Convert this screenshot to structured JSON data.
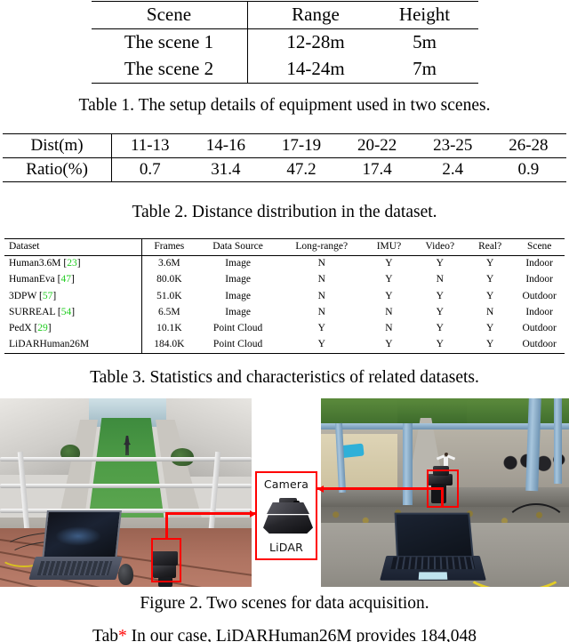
{
  "table1": {
    "headers": [
      "Scene",
      "Range",
      "Height"
    ],
    "rows": [
      [
        "The scene 1",
        "12-28m",
        "5m"
      ],
      [
        "The scene 2",
        "14-24m",
        "7m"
      ]
    ],
    "caption": "Table 1. The setup details of equipment used in two scenes."
  },
  "table2": {
    "row_labels": [
      "Dist(m)",
      "Ratio(%)"
    ],
    "distances": [
      "11-13",
      "14-16",
      "17-19",
      "20-22",
      "23-25",
      "26-28"
    ],
    "ratios": [
      "0.7",
      "31.4",
      "47.2",
      "17.4",
      "2.4",
      "0.9"
    ],
    "caption": "Table 2. Distance distribution in the dataset."
  },
  "table3": {
    "headers": [
      "Dataset",
      "Frames",
      "Data Source",
      "Long-range?",
      "IMU?",
      "Video?",
      "Real?",
      "Scene"
    ],
    "rows": [
      {
        "dataset": "Human3.6M",
        "ref": "23",
        "frames": "3.6M",
        "source": "Image",
        "long_range": "N",
        "imu": "Y",
        "video": "Y",
        "real": "Y",
        "scene": "Indoor"
      },
      {
        "dataset": "HumanEva",
        "ref": "47",
        "frames": "80.0K",
        "source": "Image",
        "long_range": "N",
        "imu": "Y",
        "video": "N",
        "real": "Y",
        "scene": "Indoor"
      },
      {
        "dataset": "3DPW",
        "ref": "57",
        "frames": "51.0K",
        "source": "Image",
        "long_range": "N",
        "imu": "Y",
        "video": "Y",
        "real": "Y",
        "scene": "Outdoor"
      },
      {
        "dataset": "SURREAL",
        "ref": "54",
        "frames": "6.5M",
        "source": "Image",
        "long_range": "N",
        "imu": "N",
        "video": "Y",
        "real": "N",
        "scene": "Indoor"
      },
      {
        "dataset": "PedX",
        "ref": "29",
        "frames": "10.1K",
        "source": "Point Cloud",
        "long_range": "Y",
        "imu": "N",
        "video": "Y",
        "real": "Y",
        "scene": "Outdoor"
      },
      {
        "dataset": "LiDARHuman26M",
        "ref": "",
        "frames": "184.0K",
        "source": "Point Cloud",
        "long_range": "Y",
        "imu": "Y",
        "video": "Y",
        "real": "Y",
        "scene": "Outdoor"
      }
    ],
    "caption": "Table 3. Statistics and characteristics of related datasets.",
    "ref_color": "#22cc22"
  },
  "figure": {
    "caption": "Figure 2. Two scenes for data acquisition.",
    "callout": {
      "top_label": "Camera",
      "bottom_label": "LiDAR",
      "box_color": "#ff0000"
    },
    "left_photo_alt": "Scene 1: balcony overlooking a green lawn courtyard with a laptop and LiDAR device on the railing deck",
    "right_photo_alt": "Scene 2: rooftop terrace with blue pillars, a person with arms outstretched below, a laptop and LiDAR on the concrete ledge"
  },
  "cutoff_line": {
    "pre": "Tab",
    "marker": "*",
    "post": "In our case, LiDARHuman26M provides 184,048"
  }
}
